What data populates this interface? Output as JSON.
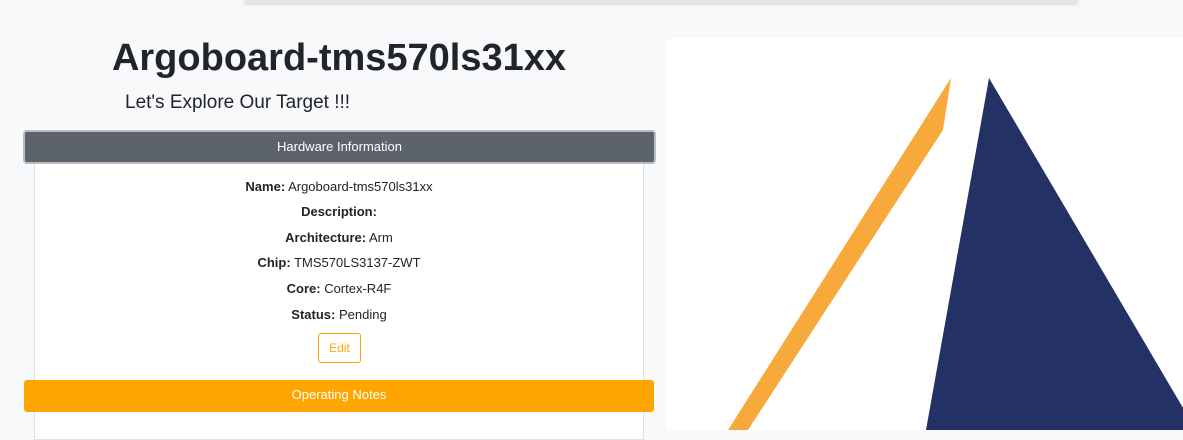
{
  "page": {
    "title": "Argoboard-tms570ls31xx",
    "subtitle": "Let's Explore Our Target !!!"
  },
  "hardware": {
    "header": "Hardware Information",
    "fields": {
      "name": {
        "label": "Name:",
        "value": "Argoboard-tms570ls31xx"
      },
      "description": {
        "label": "Description:",
        "value": ""
      },
      "architecture": {
        "label": "Architecture:",
        "value": "Arm"
      },
      "chip": {
        "label": "Chip:",
        "value": "TMS570LS3137-ZWT"
      },
      "core": {
        "label": "Core:",
        "value": "Cortex-R4F"
      },
      "status": {
        "label": "Status:",
        "value": "Pending"
      }
    },
    "edit_label": "Edit"
  },
  "operating_notes": {
    "header": "Operating Notes"
  },
  "colors": {
    "accent": "#ffa500",
    "header_gray": "#5c636a",
    "navy": "#233164",
    "stripe_orange": "#f7a93b"
  }
}
